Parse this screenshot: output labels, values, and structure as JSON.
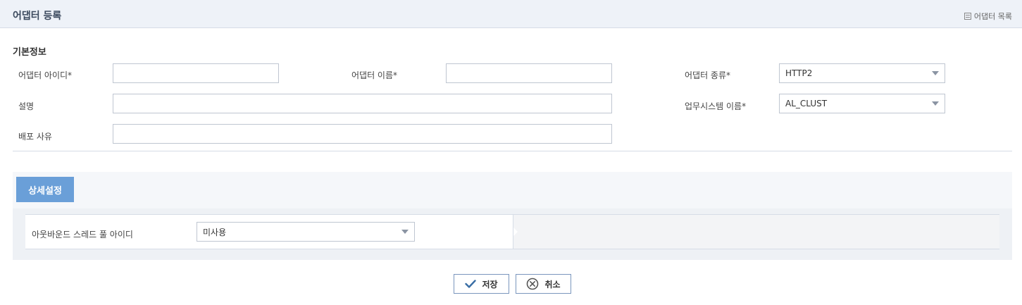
{
  "header": {
    "title": "어댑터 등록",
    "list_link": "어댑터 목록"
  },
  "basic": {
    "section_title": "기본정보",
    "adapter_id_label": "어댑터 아이디*",
    "adapter_id_value": "",
    "adapter_name_label": "어댑터 이름*",
    "adapter_name_value": "",
    "adapter_type_label": "어댑터 종류*",
    "adapter_type_value": "HTTP2",
    "description_label": "설명",
    "description_value": "",
    "biz_system_label": "업무시스템 이름*",
    "biz_system_value": "AL_CLUST",
    "deploy_reason_label": "배포 사유",
    "deploy_reason_value": ""
  },
  "detail": {
    "tab_label": "상세설정",
    "outbound_thread_label": "아웃바운드 스레드 풀 아이디",
    "outbound_thread_value": "미사용"
  },
  "actions": {
    "save_label": "저장",
    "cancel_label": "취소"
  },
  "colors": {
    "header_bg": "#eef2f8",
    "tab_bg": "#6a9fd8",
    "check_icon": "#3a6ea5"
  }
}
